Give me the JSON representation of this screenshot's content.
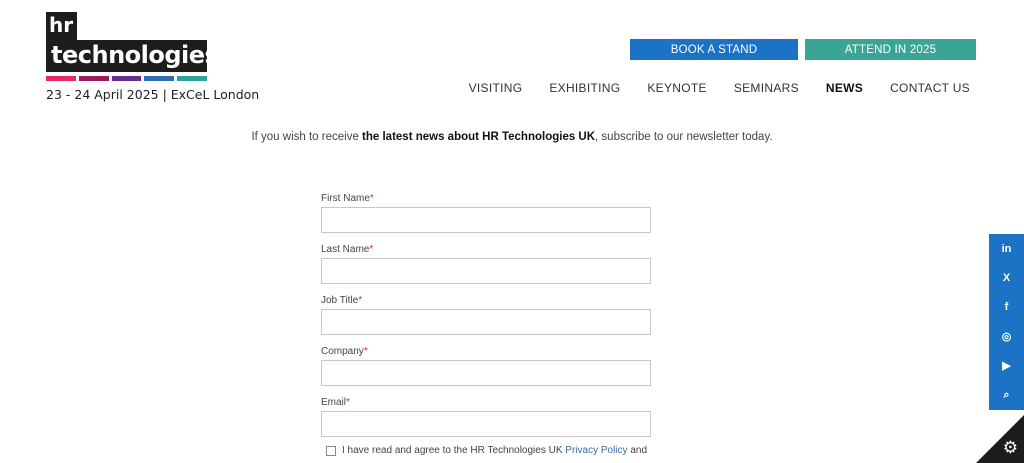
{
  "brand": {
    "logo_line1": "hr",
    "logo_line2": "technologies",
    "logo_bar_colors": [
      "#e8276b",
      "#9b1b5a",
      "#6a2c8c",
      "#2f6db5",
      "#2aa39a"
    ],
    "event_date": "23 - 24 April 2025 | ExCeL London"
  },
  "header": {
    "book_label": "BOOK A STAND",
    "attend_label": "ATTEND IN 2025",
    "book_color": "#1c72c4",
    "attend_color": "#3aa592"
  },
  "nav": {
    "items": [
      {
        "label": "VISITING"
      },
      {
        "label": "EXHIBITING"
      },
      {
        "label": "KEYNOTE"
      },
      {
        "label": "SEMINARS"
      },
      {
        "label": "NEWS",
        "active": true
      },
      {
        "label": "CONTACT US"
      }
    ]
  },
  "intro": {
    "prefix": "If you wish to receive ",
    "bold": "the latest news about HR Technologies UK",
    "suffix": ", subscribe to our newsletter today."
  },
  "form": {
    "fields": [
      {
        "label": "First Name",
        "required": "*",
        "value": ""
      },
      {
        "label": "Last Name",
        "required": "*",
        "value": ""
      },
      {
        "label": "Job Title",
        "required": "*",
        "value": ""
      },
      {
        "label": "Company",
        "required": "*",
        "value": ""
      },
      {
        "label": "Email",
        "required": "*",
        "value": ""
      }
    ],
    "consent_text": "I have read and agree to the HR Technologies UK ",
    "privacy_link": "Privacy Policy",
    "consent_tail": " and"
  },
  "social": {
    "color": "#1c72c4",
    "items": [
      {
        "icon": "linkedin-icon",
        "glyph": "in"
      },
      {
        "icon": "x-icon",
        "glyph": "X"
      },
      {
        "icon": "facebook-icon",
        "glyph": "f"
      },
      {
        "icon": "instagram-icon",
        "glyph": "◎"
      },
      {
        "icon": "youtube-icon",
        "glyph": "▶"
      },
      {
        "icon": "search-icon",
        "glyph": "⌕"
      }
    ]
  },
  "settings": {
    "icon": "gear-icon",
    "glyph": "⚙"
  }
}
